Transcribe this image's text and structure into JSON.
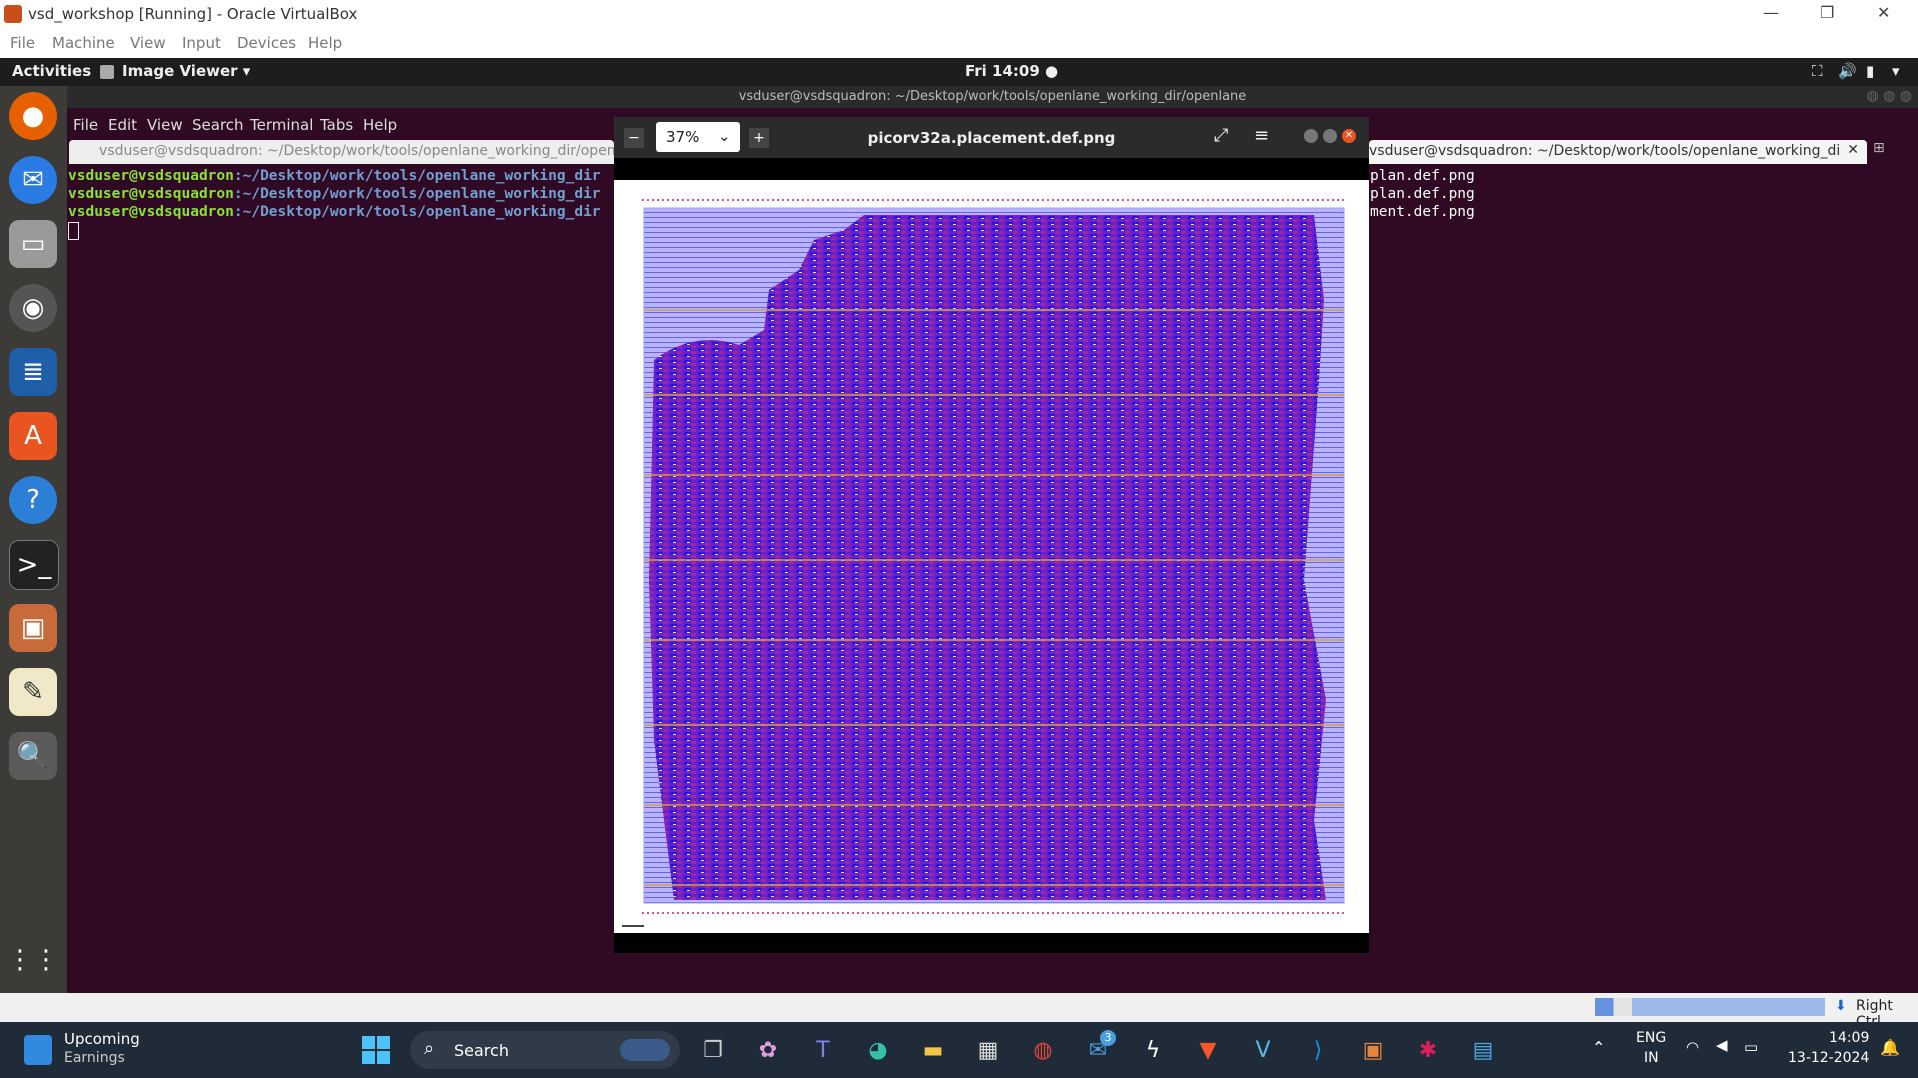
{
  "vbox": {
    "title": "vsd_workshop [Running] - Oracle VirtualBox",
    "menu": [
      "File",
      "Machine",
      "View",
      "Input",
      "Devices",
      "Help"
    ]
  },
  "gnome": {
    "activities": "Activities",
    "app": "Image Viewer ▾",
    "clock": "Fri 14:09 ●"
  },
  "terminal": {
    "window_title": "vsduser@vsdsquadron: ~/Desktop/work/tools/openlane_working_dir/openlane",
    "menu": [
      "File",
      "Edit",
      "View",
      "Search",
      "Terminal",
      "Tabs",
      "Help"
    ],
    "tab_left": "vsduser@vsdsquadron: ~/Desktop/work/tools/openlane_working_dir/openla",
    "tab_right": "vsduser@vsdsquadron: ~/Desktop/work/tools/openlane_working_dir/openlane",
    "prompt_user": "vsduser@vsdsquadron",
    "prompt_path": ":~/Desktop/work/tools/openlane_working_dir",
    "right_lines": [
      "plan.def.png",
      "plan.def.png",
      "ment.def.png"
    ]
  },
  "viewer": {
    "zoom": "37%",
    "title": "picorv32a.placement.def.png"
  },
  "taskbar": {
    "widget_title": "Upcoming",
    "widget_sub": "Earnings",
    "search": "Search",
    "lang1": "ENG",
    "lang2": "IN",
    "time": "14:09",
    "date": "13-12-2024",
    "badge": "3"
  },
  "vbox_status": {
    "host_key": "Right Ctrl"
  }
}
